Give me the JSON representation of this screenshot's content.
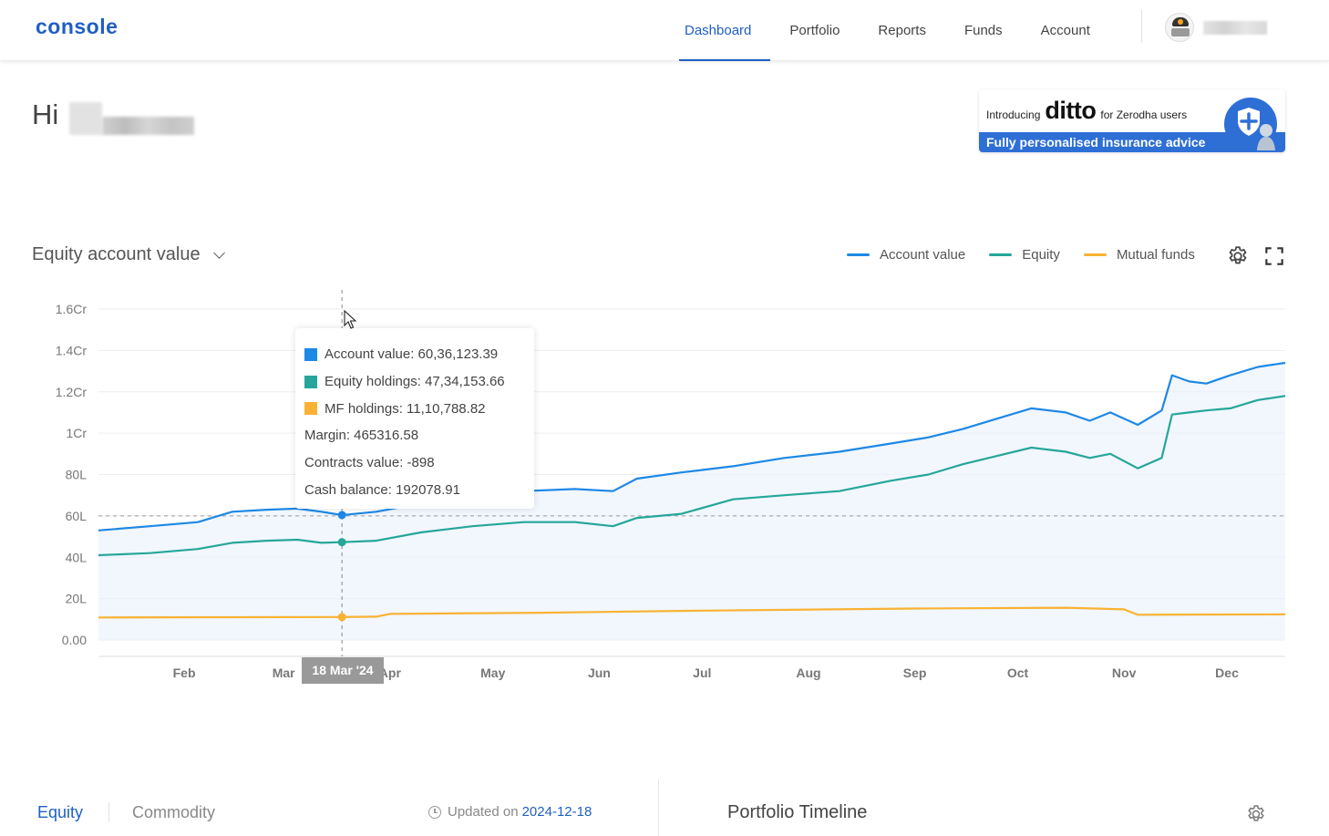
{
  "header": {
    "logo": "console",
    "nav": [
      {
        "label": "Dashboard",
        "active": true
      },
      {
        "label": "Portfolio",
        "active": false
      },
      {
        "label": "Reports",
        "active": false
      },
      {
        "label": "Funds",
        "active": false
      },
      {
        "label": "Account",
        "active": false
      }
    ]
  },
  "greeting": {
    "prefix": "Hi"
  },
  "banner": {
    "intro": "Introducing",
    "brand": "ditto",
    "suffix": "for Zerodha users",
    "tagline": "Fully personalised insurance advice"
  },
  "chart_header": {
    "title": "Equity account value",
    "legend": [
      {
        "label": "Account value",
        "color": "#1e88e5"
      },
      {
        "label": "Equity",
        "color": "#26a69a"
      },
      {
        "label": "Mutual funds",
        "color": "#f9b233"
      }
    ],
    "settings_icon": "gear-icon",
    "fullscreen_icon": "expand-icon"
  },
  "tooltip": {
    "rows": [
      {
        "text": "Account value: 60,36,123.39",
        "color": "#1e88e5"
      },
      {
        "text": "Equity holdings: 47,34,153.66",
        "color": "#26a69a"
      },
      {
        "text": "MF holdings: 11,10,788.82",
        "color": "#f9b233"
      },
      {
        "text": "Margin: 465316.58"
      },
      {
        "text": "Contracts value: -898"
      },
      {
        "text": "Cash balance: 192078.91"
      }
    ],
    "date_label": "18 Mar '24"
  },
  "chart_data": {
    "type": "line",
    "y_unit": "INR (lakh)",
    "y_ticks": [
      "0.00",
      "20L",
      "40L",
      "60L",
      "80L",
      "1Cr",
      "1.2Cr",
      "1.4Cr",
      "1.6Cr"
    ],
    "y_tick_values": [
      0,
      20,
      40,
      60,
      80,
      100,
      120,
      140,
      160
    ],
    "ylim": [
      0,
      160
    ],
    "x_ticks": [
      "Feb",
      "Mar",
      "Apr",
      "May",
      "Jun",
      "Jul",
      "Aug",
      "Sep",
      "Oct",
      "Nov",
      "Dec"
    ],
    "x_tick_dates": [
      "2024-02-01",
      "2024-03-01",
      "2024-04-01",
      "2024-05-01",
      "2024-06-01",
      "2024-07-01",
      "2024-08-01",
      "2024-09-01",
      "2024-10-01",
      "2024-11-01",
      "2024-12-01"
    ],
    "xlim": [
      "2024-01-07",
      "2024-12-18"
    ],
    "crosshair_date": "2024-03-18",
    "reference_line_y": 60,
    "series": [
      {
        "name": "Account value",
        "color": "#1e88e5",
        "points": [
          [
            "2024-01-07",
            53
          ],
          [
            "2024-01-22",
            55
          ],
          [
            "2024-02-05",
            57
          ],
          [
            "2024-02-15",
            62
          ],
          [
            "2024-02-25",
            63
          ],
          [
            "2024-03-05",
            63.5
          ],
          [
            "2024-03-12",
            62
          ],
          [
            "2024-03-18",
            60.4
          ],
          [
            "2024-03-28",
            62
          ],
          [
            "2024-04-10",
            66
          ],
          [
            "2024-04-25",
            70
          ],
          [
            "2024-05-10",
            72
          ],
          [
            "2024-05-25",
            73
          ],
          [
            "2024-06-05",
            72
          ],
          [
            "2024-06-12",
            78
          ],
          [
            "2024-06-25",
            81
          ],
          [
            "2024-07-10",
            84
          ],
          [
            "2024-07-25",
            88
          ],
          [
            "2024-08-10",
            91
          ],
          [
            "2024-08-25",
            95
          ],
          [
            "2024-09-05",
            98
          ],
          [
            "2024-09-15",
            102
          ],
          [
            "2024-09-25",
            107
          ],
          [
            "2024-10-05",
            112
          ],
          [
            "2024-10-15",
            110
          ],
          [
            "2024-10-22",
            106
          ],
          [
            "2024-10-28",
            110
          ],
          [
            "2024-11-05",
            104
          ],
          [
            "2024-11-12",
            111
          ],
          [
            "2024-11-15",
            128
          ],
          [
            "2024-11-20",
            125
          ],
          [
            "2024-11-25",
            124
          ],
          [
            "2024-12-02",
            128
          ],
          [
            "2024-12-10",
            132
          ],
          [
            "2024-12-18",
            134
          ]
        ]
      },
      {
        "name": "Equity",
        "color": "#26a69a",
        "points": [
          [
            "2024-01-07",
            41
          ],
          [
            "2024-01-22",
            42
          ],
          [
            "2024-02-05",
            44
          ],
          [
            "2024-02-15",
            47
          ],
          [
            "2024-02-25",
            48
          ],
          [
            "2024-03-05",
            48.5
          ],
          [
            "2024-03-12",
            47
          ],
          [
            "2024-03-18",
            47.3
          ],
          [
            "2024-03-28",
            48
          ],
          [
            "2024-04-10",
            52
          ],
          [
            "2024-04-25",
            55
          ],
          [
            "2024-05-10",
            57
          ],
          [
            "2024-05-25",
            57
          ],
          [
            "2024-06-05",
            55
          ],
          [
            "2024-06-12",
            59
          ],
          [
            "2024-06-25",
            61
          ],
          [
            "2024-07-10",
            68
          ],
          [
            "2024-07-25",
            70
          ],
          [
            "2024-08-10",
            72
          ],
          [
            "2024-08-25",
            77
          ],
          [
            "2024-09-05",
            80
          ],
          [
            "2024-09-15",
            85
          ],
          [
            "2024-09-25",
            89
          ],
          [
            "2024-10-05",
            93
          ],
          [
            "2024-10-15",
            91
          ],
          [
            "2024-10-22",
            88
          ],
          [
            "2024-10-28",
            90
          ],
          [
            "2024-11-05",
            83
          ],
          [
            "2024-11-12",
            88
          ],
          [
            "2024-11-15",
            109
          ],
          [
            "2024-11-20",
            110
          ],
          [
            "2024-11-25",
            111
          ],
          [
            "2024-12-02",
            112
          ],
          [
            "2024-12-10",
            116
          ],
          [
            "2024-12-18",
            118
          ]
        ]
      },
      {
        "name": "Mutual funds",
        "color": "#f9b233",
        "points": [
          [
            "2024-01-07",
            10.9
          ],
          [
            "2024-02-15",
            11
          ],
          [
            "2024-03-18",
            11.1
          ],
          [
            "2024-03-28",
            11.3
          ],
          [
            "2024-04-01",
            12.6
          ],
          [
            "2024-05-15",
            13.2
          ],
          [
            "2024-07-01",
            14.2
          ],
          [
            "2024-09-01",
            15.2
          ],
          [
            "2024-10-15",
            15.6
          ],
          [
            "2024-11-01",
            14.8
          ],
          [
            "2024-11-05",
            12.2
          ],
          [
            "2024-12-18",
            12.4
          ]
        ]
      }
    ]
  },
  "bottom": {
    "tabs": [
      {
        "label": "Equity",
        "active": true
      },
      {
        "label": "Commodity",
        "active": false
      }
    ],
    "updated_prefix": "Updated on",
    "updated_date": "2024-12-18",
    "timeline_title": "Portfolio Timeline"
  }
}
